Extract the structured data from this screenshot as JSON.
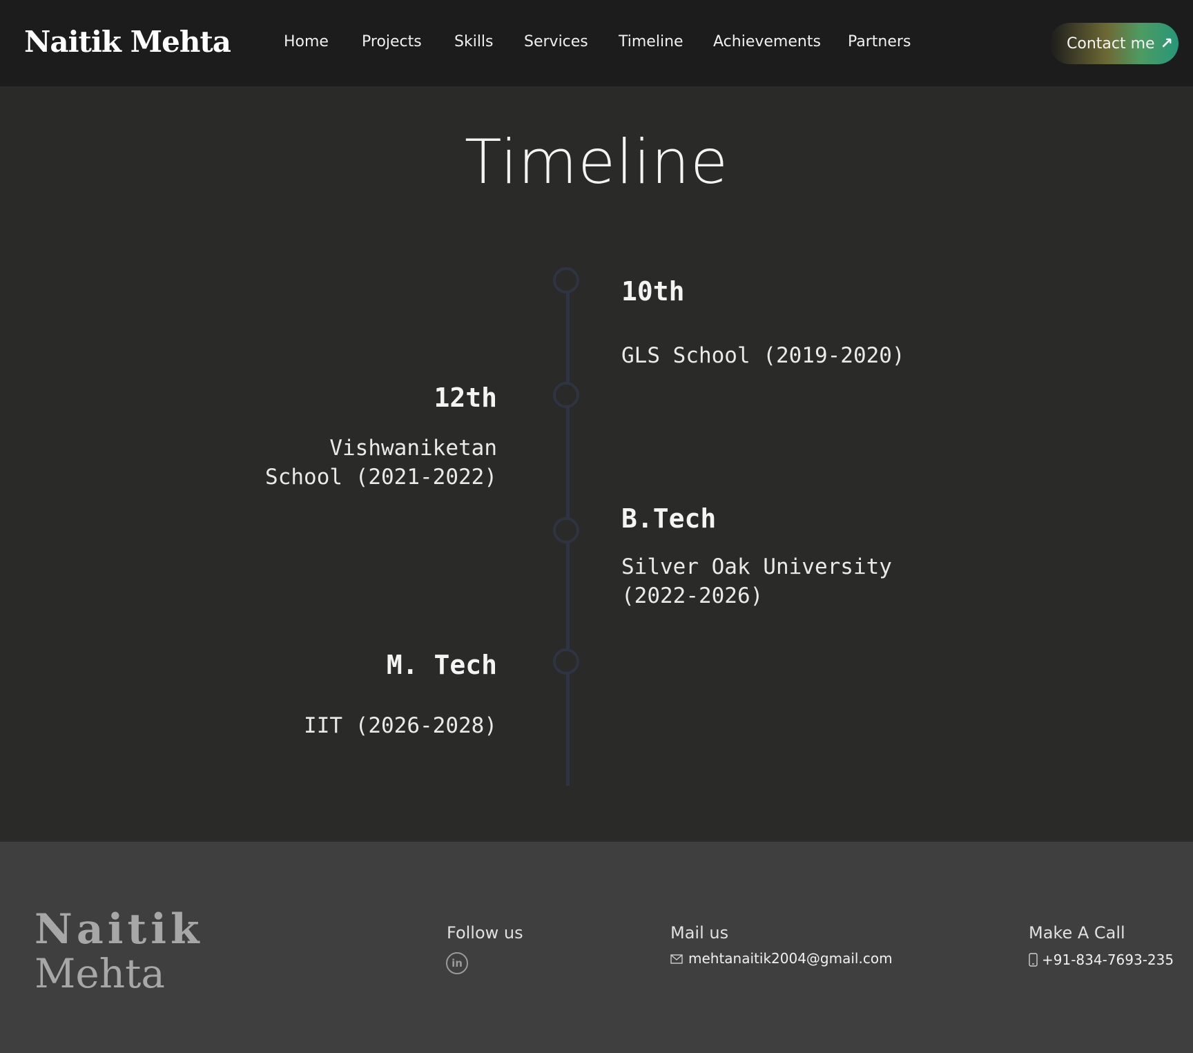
{
  "header": {
    "logo": "Naitik Mehta",
    "nav": [
      "Home",
      "Projects",
      "Skills",
      "Services",
      "Timeline",
      "Achievements",
      "Partners"
    ],
    "contact_label": "Contact me"
  },
  "page_title": "Timeline",
  "timeline": [
    {
      "heading": "10th",
      "detail": "GLS School (2019-2020)",
      "side": "right"
    },
    {
      "heading": "12th",
      "detail": "Vishwaniketan School (2021-2022)",
      "side": "left"
    },
    {
      "heading": "B.Tech",
      "detail": "Silver Oak University (2022-2026)",
      "side": "right"
    },
    {
      "heading": "M. Tech",
      "detail": "IIT (2026-2028)",
      "side": "left"
    }
  ],
  "footer": {
    "logo_first": "Naitik",
    "logo_last": "Mehta",
    "follow_label": "Follow us",
    "social_icon": "linkedin-icon",
    "mail_label": "Mail us",
    "email": "mehtanaitik2004@gmail.com",
    "call_label": "Make A Call",
    "phone": "+91-834-7693-235"
  },
  "colors": {
    "header_bg": "#1c1c1c",
    "page_bg": "#2a2a29",
    "footer_bg": "#3f3f3f",
    "timeline_line": "#2f3443",
    "accent_gradient_end": "#26977a"
  }
}
